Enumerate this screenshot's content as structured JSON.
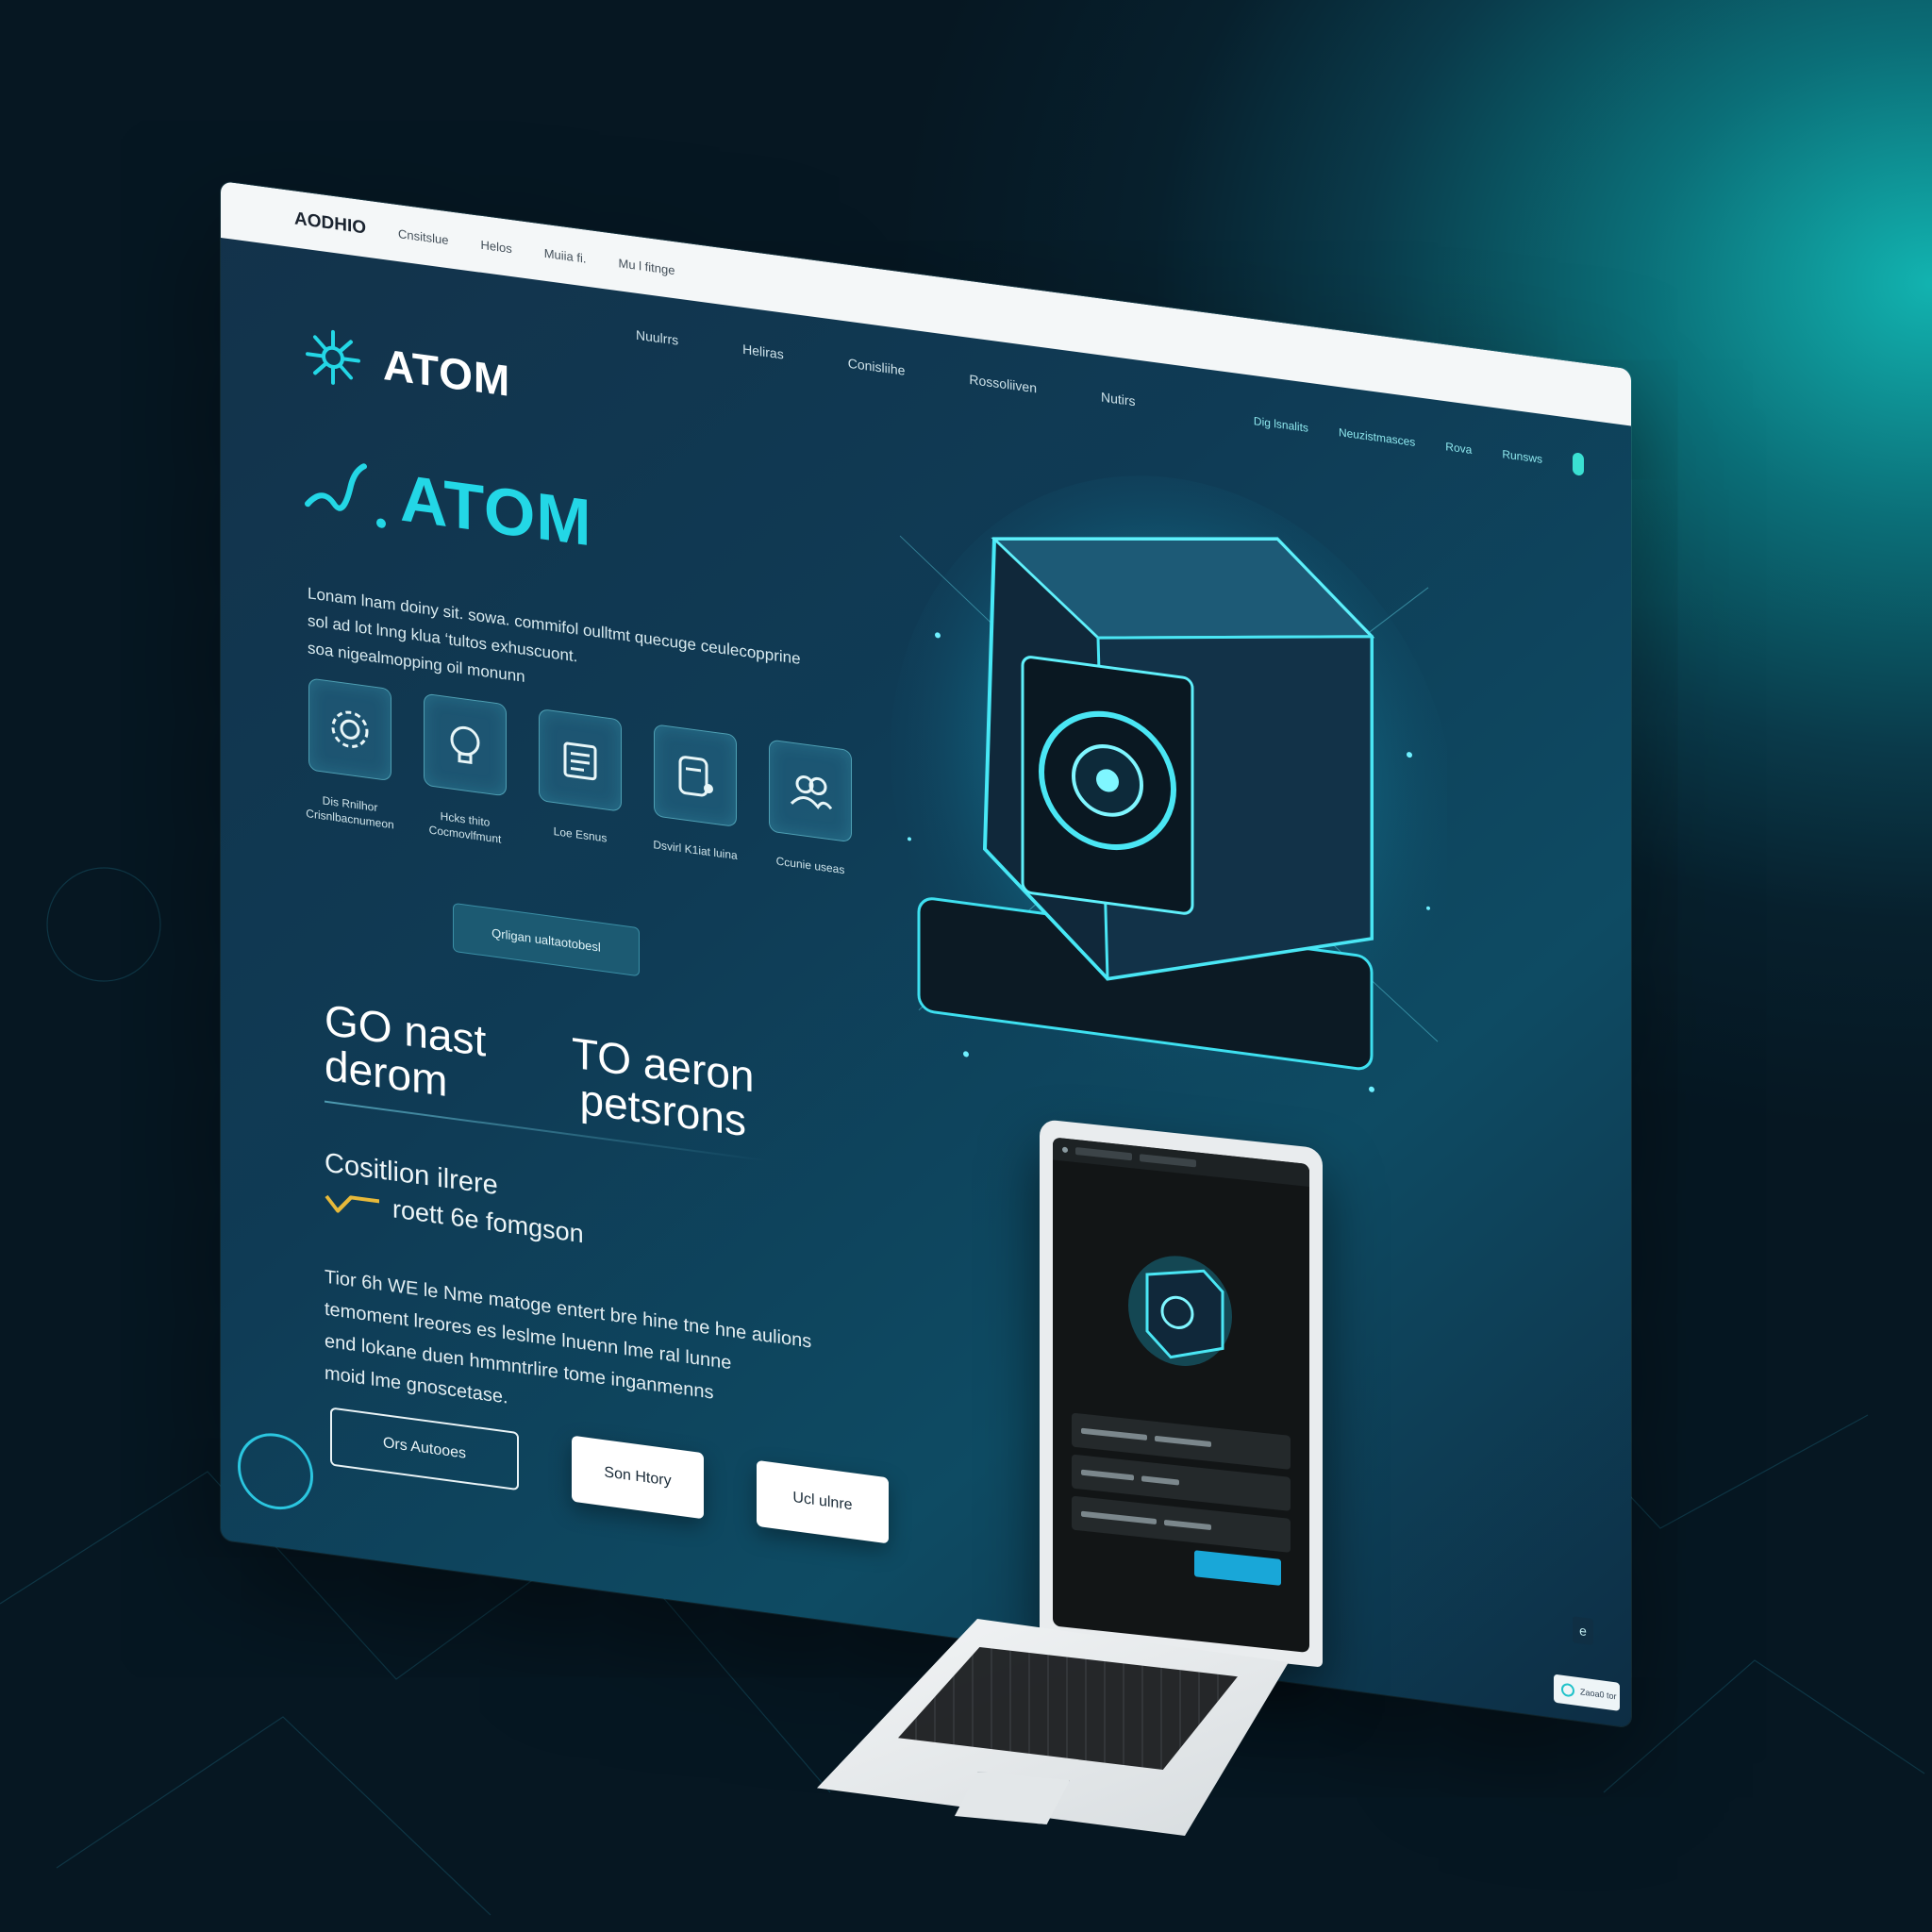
{
  "browser": {
    "brand": "AODHIO",
    "links": [
      "Cnsitslue",
      "Helos",
      "Muiia fi.",
      "Mu l fitnge"
    ]
  },
  "nav": {
    "items": [
      "Nuulrrs",
      "Heliras",
      "Conisliihe",
      "Rossoliiven",
      "Nutirs"
    ],
    "right_items": [
      "Dig lsnalits",
      "Neuzistmasces",
      "Rova",
      "Runsws"
    ]
  },
  "logo": {
    "text": "ATOM",
    "icon": "atom-star-icon"
  },
  "hero": {
    "title": "ATOM",
    "mark_text": "⊿",
    "description": [
      "Lonam lnam doiny sit. sowa. commifol oulltmt quecuge ceulecopprine",
      "sol ad lot lnng klua ‘tultos exhuscuont.",
      "soa nigealmopping oil monunn"
    ]
  },
  "features": [
    {
      "icon": "gear-chip-icon",
      "label": "Dis Rnilhor",
      "sublabel": "Crisnlbacnumeon"
    },
    {
      "icon": "lightbulb-icon",
      "label": "Hcks thito",
      "sublabel": "Cocmovlfmunt"
    },
    {
      "icon": "document-icon",
      "label": "Loe Esnus",
      "sublabel": ""
    },
    {
      "icon": "tablet-lock-icon",
      "label": "Dsvirl K1iat luina",
      "sublabel": ""
    },
    {
      "icon": "users-icon",
      "label": "Ccunie useas",
      "sublabel": ""
    }
  ],
  "secondary_cta": "Qrligan ualtaotobesl",
  "stats": {
    "left": [
      "GO  nast",
      "derom"
    ],
    "right": [
      "TO  aeron",
      "petsrons"
    ]
  },
  "caption": "Cositlion ilrere",
  "tagline": "roett 6e fomgson",
  "body": [
    "Tior 6h WE le Nme matoge entert bre hine tne hne aulions",
    "temoment lreores es leslme lnuenn lme ral lunne",
    "end lokane duen hmmntrlire tome inganmenns",
    "moid lme gnoscetase."
  ],
  "buttons": {
    "outline": "Ors Autooes",
    "primary": "Son Htory",
    "secondary": "Ucl ulnre"
  },
  "widget": {
    "chat": "Zaoa0 tor",
    "scroll": "e"
  },
  "colors": {
    "accent": "#23d7e6",
    "brand_teal": "#12b3b0",
    "background": "#061722"
  }
}
